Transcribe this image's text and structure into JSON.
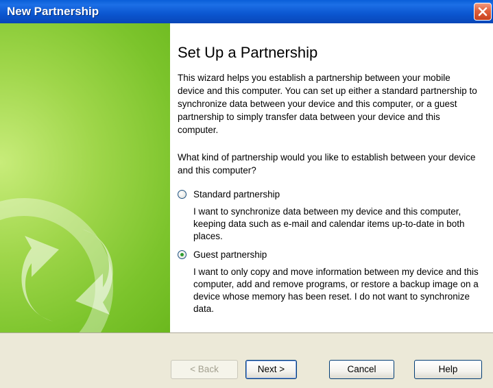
{
  "window": {
    "title": "New Partnership"
  },
  "main": {
    "heading": "Set Up a Partnership",
    "intro": "This wizard helps you establish a partnership between your mobile device and this computer.  You can set up either a standard partnership to synchronize data between your device and this computer, or a guest partnership to simply transfer data between your device and this computer.",
    "question": "What kind of partnership would you like to establish between your device and this computer?",
    "options": [
      {
        "label": "Standard partnership",
        "description": "I want to synchronize data between my device and this computer, keeping data such as e-mail and calendar items up-to-date in both places.",
        "selected": false
      },
      {
        "label": "Guest partnership",
        "description": "I want to only copy and move information between my device and this computer, add and remove programs, or restore a backup image on a device whose memory has been reset. I do not want to synchronize data.",
        "selected": true
      }
    ]
  },
  "buttons": {
    "back": "< Back",
    "next": "Next >",
    "cancel": "Cancel",
    "help": "Help"
  },
  "colors": {
    "titlebar": "#0b56d0",
    "close": "#e0603b",
    "panel_green": "#7cc42c",
    "button_face": "#ece9d8"
  }
}
